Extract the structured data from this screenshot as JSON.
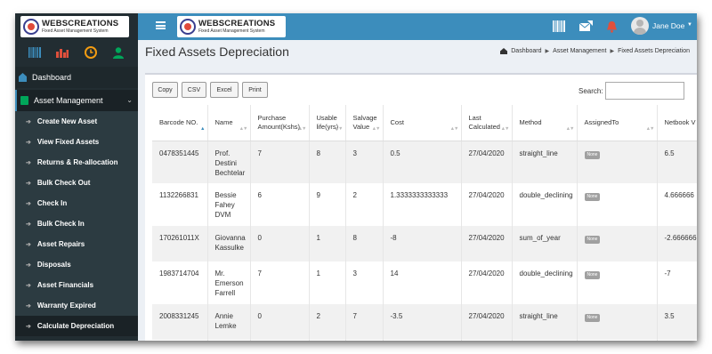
{
  "app": {
    "logo_title": "WEBSCREATIONS",
    "logo_subtitle": "Fixed Asset Management System"
  },
  "sidebar": {
    "dashboard_label": "Dashboard",
    "asset_management_label": "Asset Management",
    "submenu": [
      {
        "label": "Create New Asset"
      },
      {
        "label": "View Fixed Assets"
      },
      {
        "label": "Returns & Re-allocation"
      },
      {
        "label": "Bulk Check Out"
      },
      {
        "label": "Check In"
      },
      {
        "label": "Bulk Check In"
      },
      {
        "label": "Asset Repairs"
      },
      {
        "label": "Disposals"
      },
      {
        "label": "Asset Financials"
      },
      {
        "label": "Warranty Expired"
      },
      {
        "label": "Calculate Depreciation"
      }
    ],
    "icon_names": [
      "barcode-icon",
      "bar-chart-icon",
      "clock-icon",
      "user-icon"
    ]
  },
  "header": {
    "user_name": "Jane Doe",
    "icon_names": [
      "barcode-icon",
      "send-icon",
      "bell-icon"
    ]
  },
  "content": {
    "page_title": "Fixed Assets Depreciation",
    "breadcrumb": [
      "Dashboard",
      "Asset Management",
      "Fixed Assets Depreciation"
    ],
    "buttons": {
      "copy": "Copy",
      "csv": "CSV",
      "excel": "Excel",
      "print": "Print"
    },
    "search_label": "Search:",
    "search_value": ""
  },
  "table": {
    "headers": [
      "Barcode NO.",
      "Name",
      "Purchase Amount(Kshs)",
      "Usable life(yrs)",
      "Salvage Value",
      "Cost",
      "Last Calculated",
      "Method",
      "AssignedTo",
      "Netbook V"
    ],
    "rows": [
      {
        "barcode": "0478351445",
        "name": "Prof. Destini Bechtelar",
        "purchase": "7",
        "life": "8",
        "salvage": "3",
        "cost": "0.5",
        "last": "27/04/2020",
        "method": "straight_line",
        "assigned": "None",
        "netbook": "6.5"
      },
      {
        "barcode": "1132266831",
        "name": "Bessie Fahey DVM",
        "purchase": "6",
        "life": "9",
        "salvage": "2",
        "cost": "1.3333333333333",
        "last": "27/04/2020",
        "method": "double_declining",
        "assigned": "None",
        "netbook": "4.666666"
      },
      {
        "barcode": "170261011X",
        "name": "Giovanna Kassulke",
        "purchase": "0",
        "life": "1",
        "salvage": "8",
        "cost": "-8",
        "last": "27/04/2020",
        "method": "sum_of_year",
        "assigned": "None",
        "netbook": "-2.666666"
      },
      {
        "barcode": "1983714704",
        "name": "Mr. Emerson Farrell",
        "purchase": "7",
        "life": "1",
        "salvage": "3",
        "cost": "14",
        "last": "27/04/2020",
        "method": "double_declining",
        "assigned": "None",
        "netbook": "-7"
      },
      {
        "barcode": "2008331245",
        "name": "Annie Lemke",
        "purchase": "0",
        "life": "2",
        "salvage": "7",
        "cost": "-3.5",
        "last": "27/04/2020",
        "method": "straight_line",
        "assigned": "None",
        "netbook": "3.5"
      },
      {
        "barcode": "",
        "name": "",
        "purchase": "",
        "life": "",
        "salvage": "",
        "cost": "",
        "last": "",
        "method": "",
        "assigned": "",
        "netbook": ""
      }
    ]
  },
  "colors": {
    "header_blue": "#3c8dbc",
    "sidebar_dark": "#222d32",
    "sidebar_sub": "#2c3b41"
  }
}
